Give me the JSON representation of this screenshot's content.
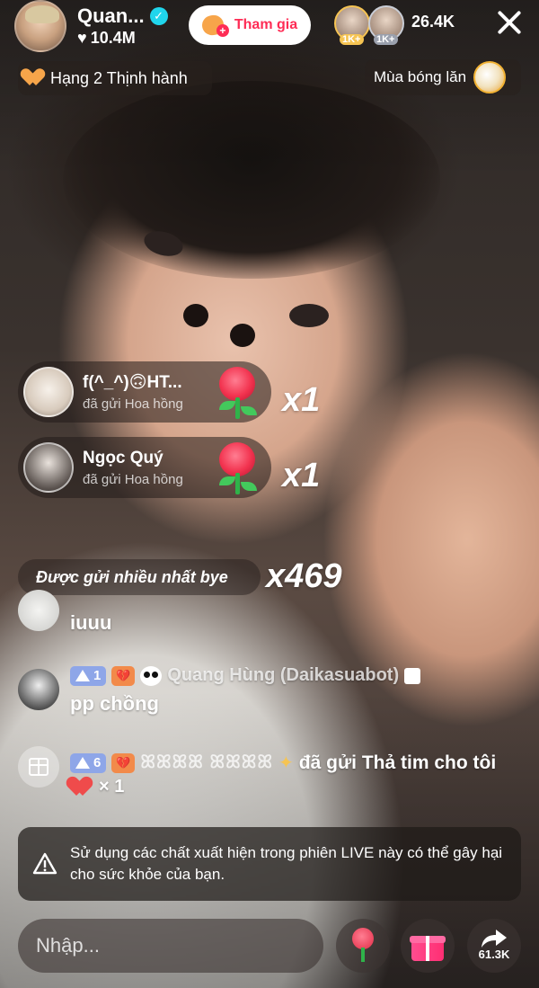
{
  "host": {
    "name": "Quan...",
    "likes": "10.4M",
    "join_label": "Tham gia"
  },
  "viewers": {
    "badges": [
      "1K+",
      "1K+"
    ],
    "count": "26.4K"
  },
  "rank_label": "Hạng 2 Thịnh hành",
  "season_label": "Mùa bóng lăn",
  "gift_toasts": [
    {
      "name": "f(^_^)🙃HT...",
      "action": "đã gửi Hoa hồng",
      "count": "x1"
    },
    {
      "name": "Ngọc Quý",
      "action": "đã gửi Hoa hồng",
      "count": "x1"
    }
  ],
  "top_gift": {
    "label": "Được gửi nhiều nhất bye",
    "count": "x469"
  },
  "chat": [
    {
      "text": "iuuu"
    },
    {
      "level": "1",
      "name": "Quang Hùng (Daikasuabot)",
      "text": "pp chồng"
    },
    {
      "level": "6",
      "name": "ꕤꕤꕤꕤ ꕤꕤꕤꕤ",
      "text": "đã gửi Thả tim cho tôi",
      "count": "× 1"
    }
  ],
  "warning": "Sử dụng các chất xuất hiện trong phiên LIVE này có thể gây hại cho sức khỏe của bạn.",
  "input": {
    "placeholder": "Nhập..."
  },
  "share_count": "61.3K",
  "colors": {
    "accent": "#fe2c55",
    "verified": "#20d5ec",
    "gold": "#f6c453"
  }
}
